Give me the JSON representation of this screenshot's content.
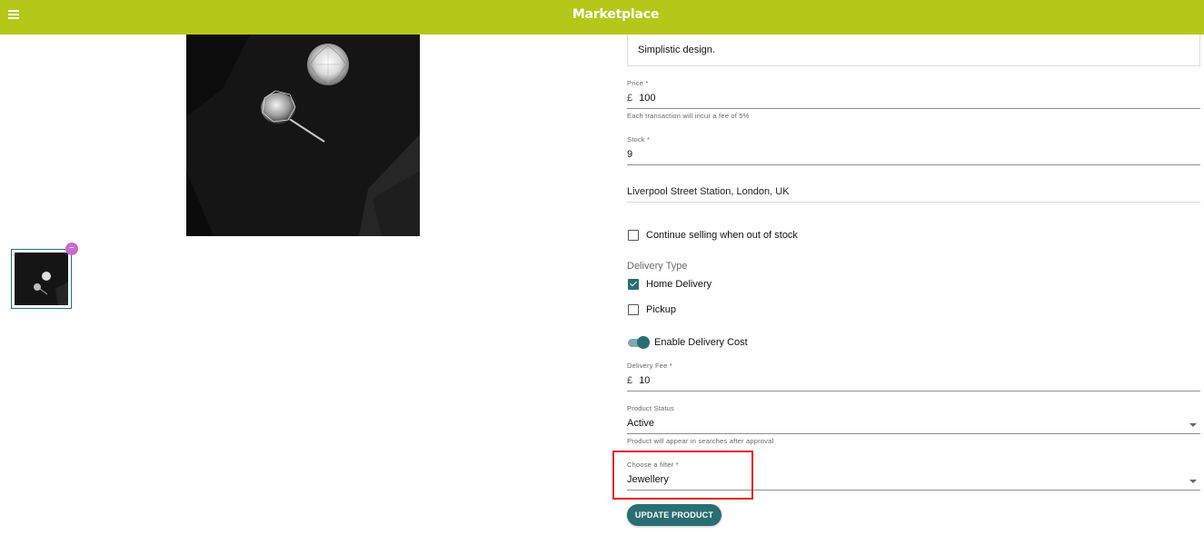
{
  "header": {
    "brand": "Marketplace"
  },
  "icons": {
    "menu": "hamburger-menu-icon",
    "remove": "remove-image-icon",
    "caret": "dropdown-caret-icon"
  },
  "gallery": {
    "remove_badge": "−"
  },
  "form": {
    "description_value": "Simplistic design.",
    "price": {
      "label": "Price *",
      "prefix": "£",
      "value": "100",
      "hint": "Each transaction will incur a fee of 5%"
    },
    "stock": {
      "label": "Stock *",
      "value": "9"
    },
    "location": {
      "value": "Liverpool Street Station, London, UK"
    },
    "continue_selling": {
      "label": "Continue selling when out of stock",
      "checked": false
    },
    "delivery_type": {
      "label": "Delivery Type",
      "options": [
        {
          "label": "Home Delivery",
          "checked": true
        },
        {
          "label": "Pickup",
          "checked": false
        }
      ]
    },
    "enable_delivery_cost": {
      "label": "Enable Delivery Cost",
      "on": true
    },
    "delivery_fee": {
      "label": "Delivery Fee *",
      "prefix": "£",
      "value": "10"
    },
    "product_status": {
      "label": "Product Status",
      "value": "Active",
      "hint": "Product will appear in searches after approval"
    },
    "filter": {
      "label": "Choose a filter *",
      "value": "Jewellery"
    },
    "submit_label": "UPDATE PRODUCT"
  },
  "colors": {
    "topbar": "#b4c81a",
    "accent": "#2a6e73",
    "remove_badge": "#c96ac9",
    "highlight": "#e0212a"
  }
}
